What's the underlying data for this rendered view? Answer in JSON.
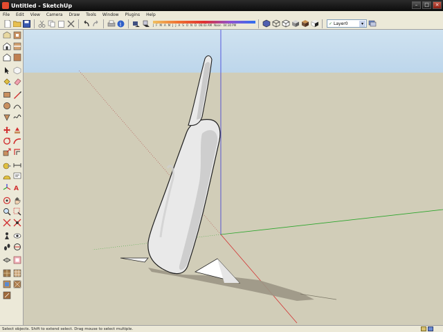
{
  "window": {
    "title": "Untitled - SketchUp"
  },
  "menu": [
    "File",
    "Edit",
    "View",
    "Camera",
    "Draw",
    "Tools",
    "Window",
    "Plugins",
    "Help"
  ],
  "toolbar": {
    "shadow_times": [
      "J",
      "F",
      "M",
      "A",
      "M",
      "J",
      "J",
      "A",
      "S",
      "O",
      "N",
      "D",
      "06:43 AM",
      "Noon",
      "04:30 PM"
    ],
    "layer": "Layer0"
  },
  "status": {
    "text": "Select objects. Shift to extend select. Drag mouse to select multiple."
  },
  "colors": {
    "sky": "#bdd6eb",
    "ground": "#d1cdb8",
    "axis_red": "#d23030",
    "axis_green": "#2aa52a",
    "axis_blue": "#3636d8"
  }
}
